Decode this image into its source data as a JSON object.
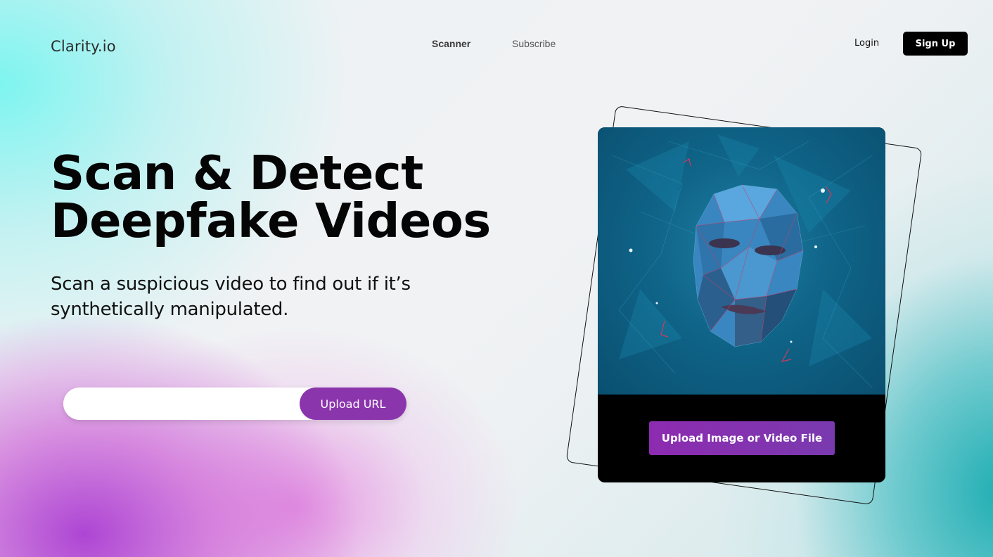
{
  "nav": {
    "logo": "Clarity.io",
    "links": [
      "Scanner",
      "Subscribe"
    ],
    "login": "Login",
    "signup": "Sign Up"
  },
  "hero": {
    "title_line1": "Scan & Detect",
    "title_line2": "Deepfake Videos",
    "subtitle": "Scan a suspicious video to find out if it’s synthetically manipulated.",
    "url_input_value": "",
    "url_input_placeholder": "",
    "upload_url_label": "Upload URL"
  },
  "card": {
    "image_icon": "wireframe-face-icon",
    "upload_file_label": "Upload Image or Video File"
  },
  "colors": {
    "accent_purple": "#8b35ad",
    "button_black": "#000000",
    "card_blue": "#0f6488"
  }
}
